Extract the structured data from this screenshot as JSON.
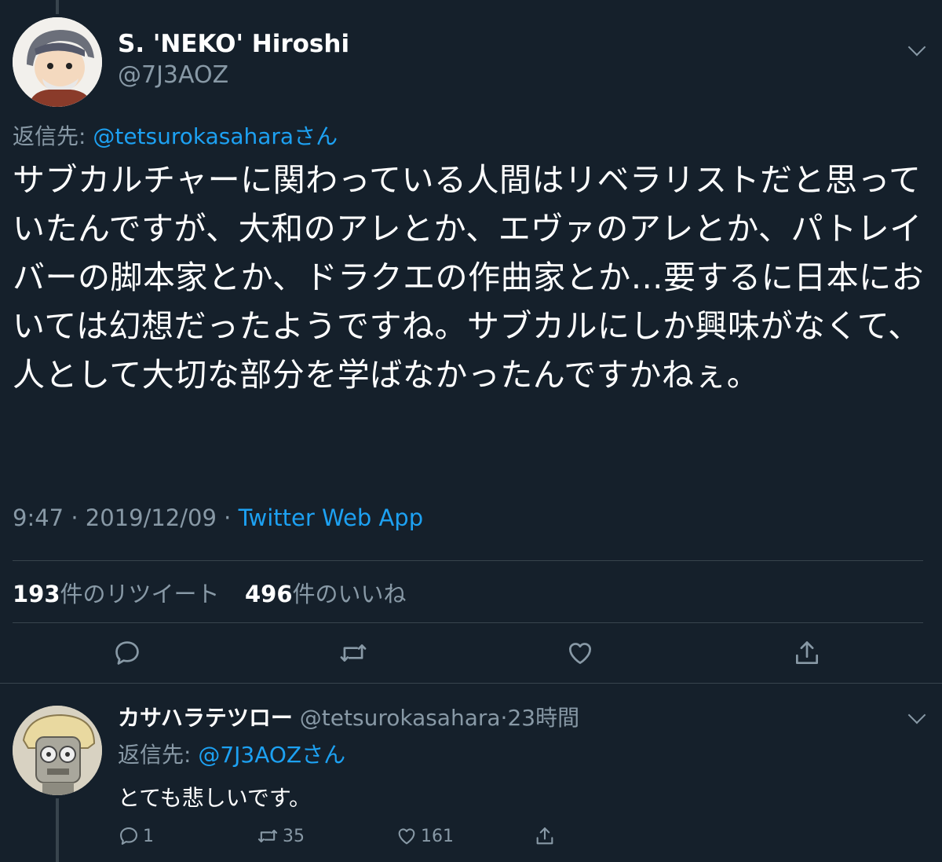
{
  "main_tweet": {
    "display_name": "S. 'NEKO' Hiroshi",
    "handle": "@7J3AOZ",
    "reply_to_prefix": "返信先: ",
    "reply_to_handle": "@tetsurokasaharaさん",
    "text": "サブカルチャーに関わっている人間はリベラリストだと思っていたんですが、大和のアレとか、エヴァのアレとか、パトレイバーの脚本家とか、ドラクエの作曲家とか…要するに日本においては幻想だったようですね。サブカルにしか興味がなくて、人として大切な部分を学ばなかったんですかねぇ。",
    "time": "9:47",
    "separator": " · ",
    "date": "2019/12/09",
    "source": "Twitter Web App",
    "retweet_count": "193",
    "retweet_label": "件のリツイート",
    "like_count": "496",
    "like_label": "件のいいね"
  },
  "reply_tweet": {
    "display_name": "カサハラテツロー",
    "handle": "@tetsurokasahara",
    "separator": "·",
    "time_ago": "23時間",
    "reply_to_prefix": "返信先: ",
    "reply_to_handle": "@7J3AOZさん",
    "text": "とても悲しいです。",
    "reply_count": "1",
    "retweet_count": "35",
    "like_count": "161"
  },
  "icons": {
    "reply": "reply-icon",
    "retweet": "retweet-icon",
    "like": "heart-icon",
    "share": "share-icon",
    "more": "chevron-down-icon"
  },
  "colors": {
    "background": "#15202b",
    "text": "#ffffff",
    "muted": "#8899a6",
    "link": "#1da1f2",
    "divider": "#38444d"
  }
}
